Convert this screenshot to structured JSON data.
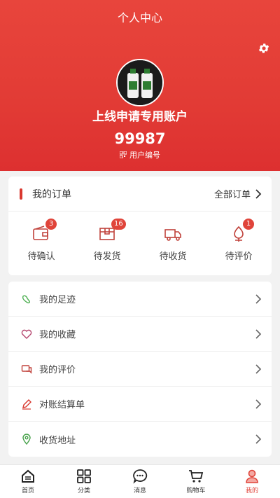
{
  "header": {
    "title": "个人中心",
    "username": "上线申请专用账户",
    "user_number": "99987",
    "user_number_label": "用户编号",
    "bg_color": "#e23b35"
  },
  "orders": {
    "title": "我的订单",
    "all_label": "全部订单",
    "items": [
      {
        "label": "待确认",
        "badge": "3",
        "icon": "wallet-icon"
      },
      {
        "label": "待发货",
        "badge": "16",
        "icon": "box-icon"
      },
      {
        "label": "待收货",
        "badge": "",
        "icon": "truck-icon"
      },
      {
        "label": "待评价",
        "badge": "1",
        "icon": "flower-icon"
      }
    ]
  },
  "menu": {
    "items": [
      {
        "label": "我的足迹",
        "icon": "footprint-icon"
      },
      {
        "label": "我的收藏",
        "icon": "heart-icon"
      },
      {
        "label": "我的评价",
        "icon": "comment-icon"
      },
      {
        "label": "对账结算单",
        "icon": "pencil-icon"
      },
      {
        "label": "收货地址",
        "icon": "location-icon"
      }
    ]
  },
  "tabbar": {
    "items": [
      {
        "label": "首页",
        "icon": "home-icon",
        "active": false
      },
      {
        "label": "分类",
        "icon": "grid-icon",
        "active": false
      },
      {
        "label": "消息",
        "icon": "chat-icon",
        "active": false
      },
      {
        "label": "购物车",
        "icon": "cart-icon",
        "active": false
      },
      {
        "label": "我的",
        "icon": "profile-icon",
        "active": true
      }
    ],
    "active_color": "#e0443a"
  }
}
